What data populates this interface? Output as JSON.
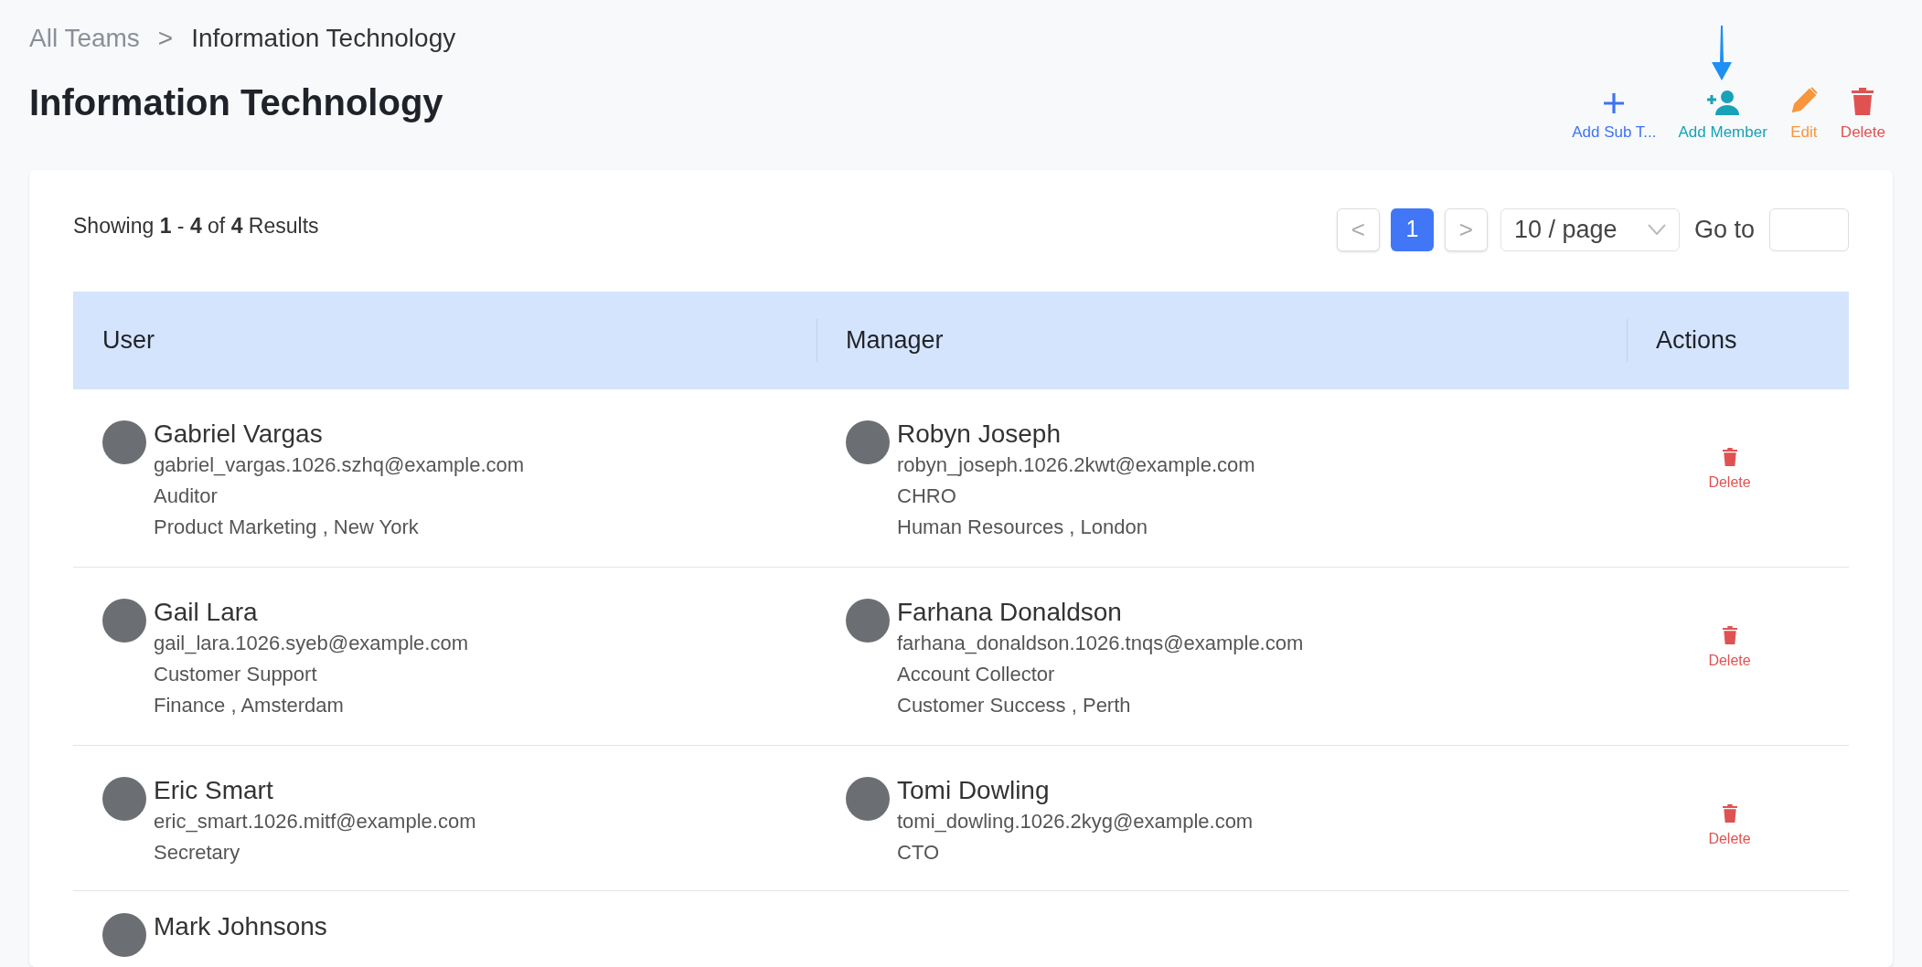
{
  "breadcrumb": [
    {
      "label": "All Teams",
      "current": false
    },
    {
      "separator": ">"
    },
    {
      "label": "Information Technology",
      "current": true
    }
  ],
  "title": "Information Technology",
  "actions": [
    {
      "kind": "add",
      "label": "Add Sub T..."
    },
    {
      "kind": "add-member",
      "label": "Add Member"
    },
    {
      "kind": "edit",
      "label": "Edit"
    },
    {
      "kind": "delete",
      "label": "Delete"
    }
  ],
  "results": "Showing **1** - **4** of **4** Results",
  "pagination": {
    "prev": "<",
    "pages": [
      {
        "label": "1",
        "selected": true
      }
    ],
    "next": ">",
    "page_size": "10 / page",
    "goto_label": "Go to"
  },
  "table": {
    "columns": [
      "User",
      "Manager",
      "Actions"
    ],
    "rows": [
      {
        "user": {
          "name": "Gabriel Vargas",
          "email": "gabriel_vargas.1026.szhq@example.com",
          "role": "Auditor",
          "location": "Product Marketing , New York"
        },
        "manager": {
          "name": "Robyn Joseph",
          "email": "robyn_joseph.1026.2kwt@example.com",
          "role": "CHRO",
          "location": "Human Resources , London"
        },
        "action": "Delete"
      },
      {
        "user": {
          "name": "Gail Lara",
          "email": "gail_lara.1026.syeb@example.com",
          "role": "Customer Support",
          "location": "Finance , Amsterdam"
        },
        "manager": {
          "name": "Farhana Donaldson",
          "email": "farhana_donaldson.1026.tnqs@example.com",
          "role": "Account Collector",
          "location": "Customer Success , Perth"
        },
        "action": "Delete"
      },
      {
        "user": {
          "name": "Eric Smart",
          "email": "eric_smart.1026.mitf@example.com",
          "role": "Secretary"
        },
        "manager": {
          "name": "Tomi Dowling",
          "email": "tomi_dowling.1026.2kyg@example.com",
          "role": "CTO"
        },
        "action": "Delete"
      },
      {
        "user": {
          "name": "Mark Johnsons"
        }
      }
    ]
  }
}
